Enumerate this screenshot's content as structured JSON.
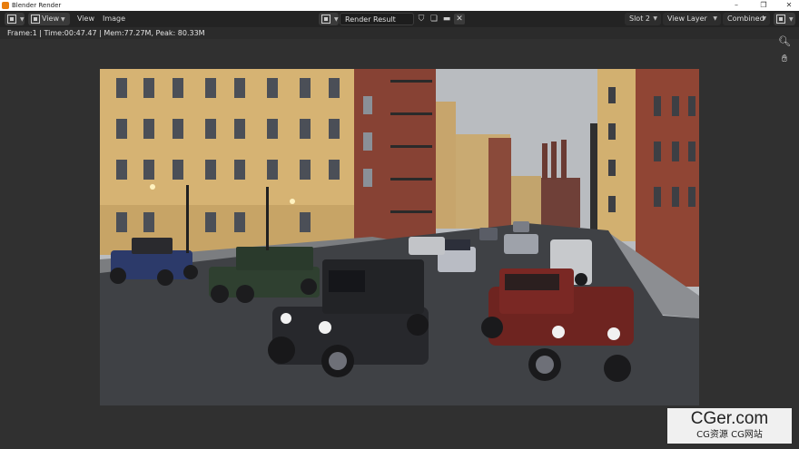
{
  "window": {
    "title": "Blender Render"
  },
  "header": {
    "view_menu_button": "View",
    "menu_view": "View",
    "menu_image": "Image",
    "image_name": "Render Result",
    "slot": "Slot 2",
    "view_layer": "View Layer",
    "pass": "Combined"
  },
  "status": {
    "frame": "Frame:1",
    "time": "Time:00:47.47",
    "mem": "Mem:77.27M, Peak: 80.33M"
  },
  "watermark": {
    "title": "CGer.com",
    "subtitle": "CG资源 CG网站"
  },
  "colors": {
    "background": "#303030",
    "header": "#232323",
    "accent": "#e87d0d"
  }
}
